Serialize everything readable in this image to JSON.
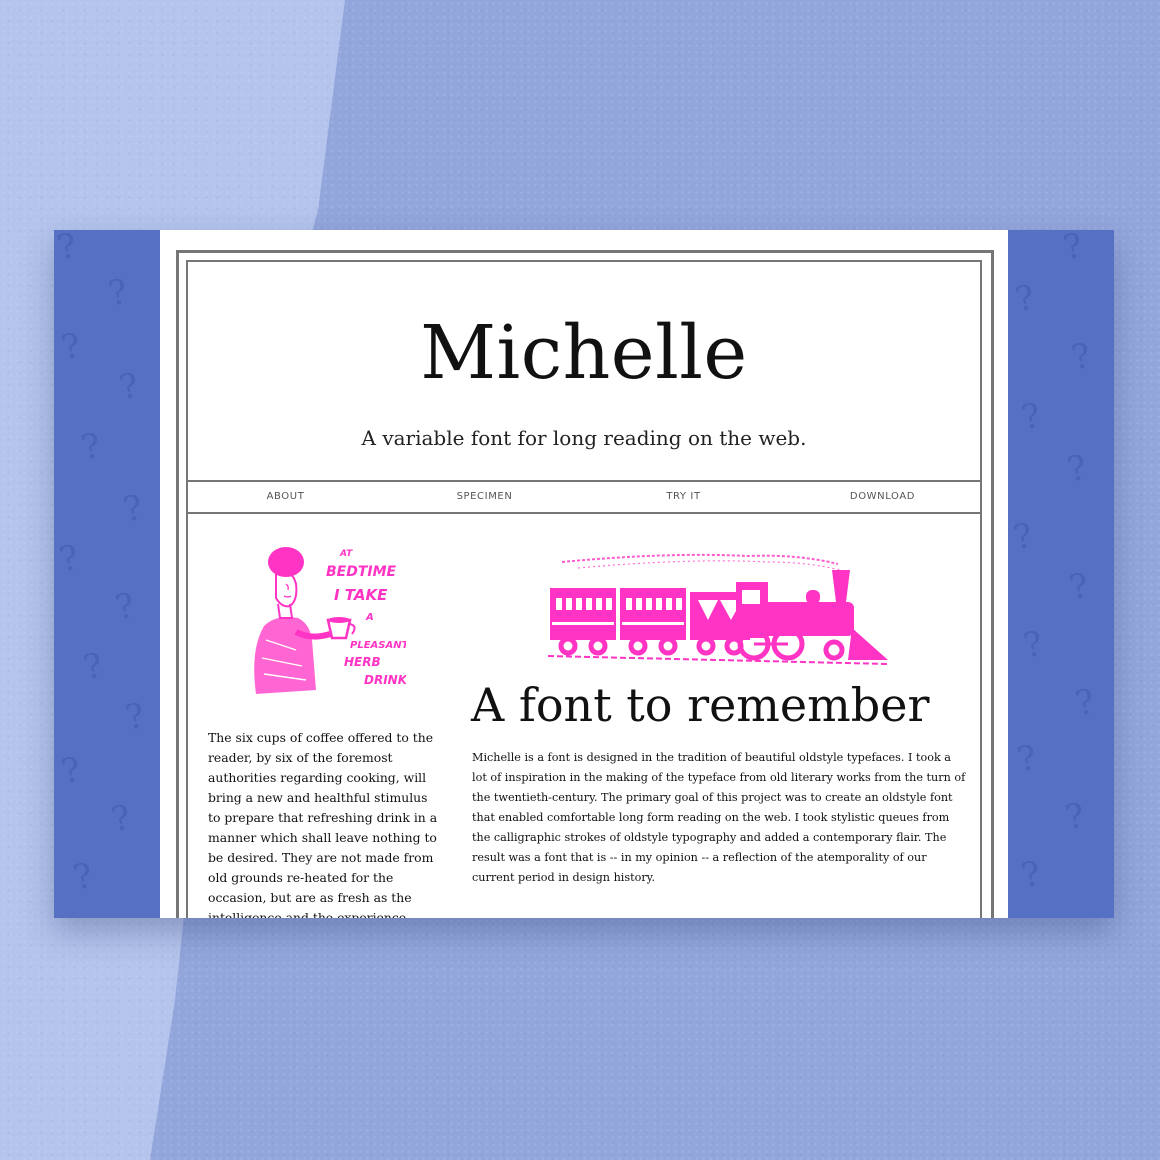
{
  "site": {
    "title": "Michelle",
    "subtitle": "A variable font for long reading on the web."
  },
  "nav": {
    "items": [
      {
        "label": "ABOUT"
      },
      {
        "label": "SPECIMEN"
      },
      {
        "label": "TRY IT"
      },
      {
        "label": "DOWNLOAD"
      }
    ]
  },
  "sidebar_ad": {
    "lines": [
      "AT",
      "BEDTIME",
      "I TAKE",
      "A",
      "PLEASANT",
      "HERB",
      "DRINK"
    ],
    "text": "The six cups of coffee offered to the reader, by six of the foremost authorities regarding cooking, will bring a new and healthful stimulus to prepare that refreshing drink in a manner which shall leave nothing to be desired. They are not made from old grounds re-heated for the occasion, but are as fresh as the intelligence and the experience which have produced them."
  },
  "main": {
    "headline": "A font to remember",
    "body": "Michelle is a font is designed in the tradition of beautiful oldstyle typefaces. I took a lot of inspiration in the making of the typeface from old literary works from the turn of the twentieth-century. The primary goal of this project was to create an oldstyle font that enabled comfortable long form reading on the web. I took stylistic queues from the calligraphic strokes of oldstyle typography and added a contemporary flair. The result was a font that is -- in my opinion -- a reflection of the atemporality of our current period in design history."
  },
  "colors": {
    "accent": "#ff33c4",
    "panel_blue": "#5670c4",
    "frame_gray": "#767676"
  },
  "decorations": {
    "pattern_icon": "question-mark-icon"
  }
}
